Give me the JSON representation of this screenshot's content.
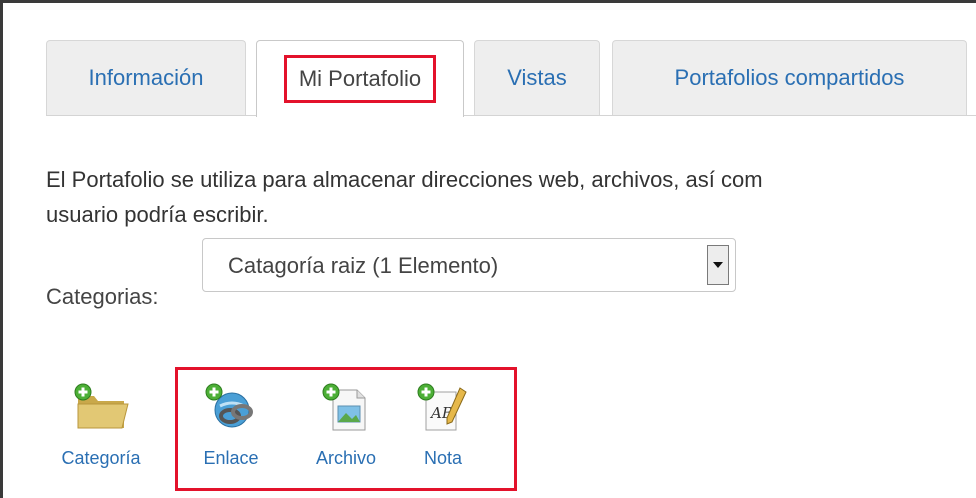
{
  "tabs": [
    {
      "label": "Información"
    },
    {
      "label": "Mi Portafolio"
    },
    {
      "label": "Vistas"
    },
    {
      "label": "Portafolios compartidos"
    }
  ],
  "description": {
    "line1": "El Portafolio se utiliza para almacenar direcciones web, archivos, así com",
    "line2": "usuario podría escribir."
  },
  "categories": {
    "label": "Categorias:",
    "selected": "Catagoría raiz (1 Elemento)"
  },
  "actions": [
    {
      "label": "Categoría",
      "icon": "folder-add-icon"
    },
    {
      "label": "Enlace",
      "icon": "link-add-icon"
    },
    {
      "label": "Archivo",
      "icon": "file-add-icon"
    },
    {
      "label": "Nota",
      "icon": "note-add-icon"
    }
  ],
  "colors": {
    "link": "#2a6fb3",
    "highlight": "#e3122b",
    "text": "#333333"
  }
}
